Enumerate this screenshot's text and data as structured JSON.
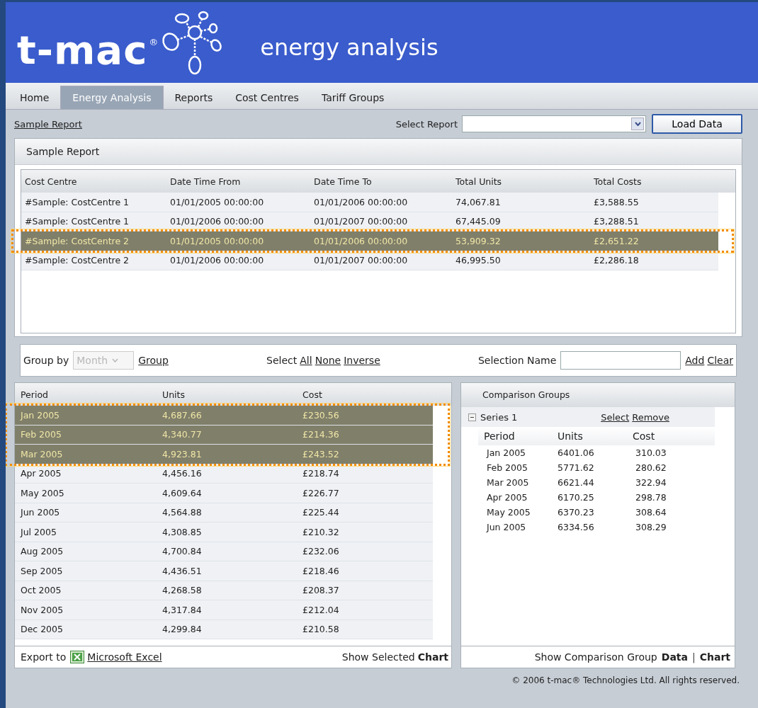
{
  "header": {
    "logo": "t-mac",
    "logo_mark": "®",
    "subtitle": "energy analysis"
  },
  "tabs": [
    {
      "label": "Home",
      "selected": false
    },
    {
      "label": "Energy Analysis",
      "selected": true
    },
    {
      "label": "Reports",
      "selected": false
    },
    {
      "label": "Cost Centres",
      "selected": false
    },
    {
      "label": "Tariff Groups",
      "selected": false
    }
  ],
  "toolbar": {
    "link": "Sample Report",
    "select_label": "Select Report",
    "button": "Load Data"
  },
  "report_panel": {
    "title": "Sample Report",
    "columns": [
      "Cost Centre",
      "Date Time From",
      "Date Time To",
      "Total Units",
      "Total Costs"
    ],
    "rows": [
      {
        "cells": [
          "#Sample: CostCentre 1",
          "01/01/2005 00:00:00",
          "01/01/2006 00:00:00",
          "74,067.81",
          "£3,588.55"
        ],
        "selected": false
      },
      {
        "cells": [
          "#Sample: CostCentre 1",
          "01/01/2006 00:00:00",
          "01/01/2007 00:00:00",
          "67,445.09",
          "£3,288.51"
        ],
        "selected": false
      },
      {
        "cells": [
          "#Sample: CostCentre 2",
          "01/01/2005 00:00:00",
          "01/01/2006 00:00:00",
          "53,909.32",
          "£2,651.22"
        ],
        "selected": true
      },
      {
        "cells": [
          "#Sample: CostCentre 2",
          "01/01/2006 00:00:00",
          "01/01/2007 00:00:00",
          "46,995.50",
          "£2,286.18"
        ],
        "selected": false
      }
    ]
  },
  "group_bar": {
    "group_by_label": "Group by",
    "group_by_value": "Month",
    "group_by_disabled": true,
    "group_link": "Group",
    "select_label": "Select",
    "select_links": [
      "All",
      "None",
      "Inverse"
    ],
    "selection_name_label": "Selection Name",
    "actions": [
      "Add",
      "Clear"
    ]
  },
  "period_table": {
    "columns": [
      "Period",
      "Units",
      "Cost"
    ],
    "rows": [
      {
        "cells": [
          "Jan 2005",
          "4,687.66",
          "£230.56"
        ],
        "selected": true
      },
      {
        "cells": [
          "Feb 2005",
          "4,340.77",
          "£214.36"
        ],
        "selected": true
      },
      {
        "cells": [
          "Mar 2005",
          "4,923.81",
          "£243.52"
        ],
        "selected": true
      },
      {
        "cells": [
          "Apr 2005",
          "4,456.16",
          "£218.74"
        ],
        "selected": false
      },
      {
        "cells": [
          "May 2005",
          "4,609.64",
          "£226.77"
        ],
        "selected": false
      },
      {
        "cells": [
          "Jun 2005",
          "4,564.88",
          "£225.44"
        ],
        "selected": false
      },
      {
        "cells": [
          "Jul 2005",
          "4,308.85",
          "£210.32"
        ],
        "selected": false
      },
      {
        "cells": [
          "Aug 2005",
          "4,700.84",
          "£232.06"
        ],
        "selected": false
      },
      {
        "cells": [
          "Sep 2005",
          "4,436.51",
          "£218.46"
        ],
        "selected": false
      },
      {
        "cells": [
          "Oct 2005",
          "4,268.58",
          "£208.37"
        ],
        "selected": false
      },
      {
        "cells": [
          "Nov 2005",
          "4,317.84",
          "£212.04"
        ],
        "selected": false
      },
      {
        "cells": [
          "Dec 2005",
          "4,299.84",
          "£210.58"
        ],
        "selected": false
      }
    ],
    "export_label": "Export to",
    "export_link": "Microsoft Excel",
    "show_label": "Show Selected",
    "show_link": "Chart"
  },
  "comparison": {
    "title": "Comparison Groups",
    "series": [
      {
        "name": "Series 1",
        "expanded": true,
        "actions": [
          "Select",
          "Remove"
        ],
        "columns": [
          "Period",
          "Units",
          "Cost"
        ],
        "rows": [
          [
            "Jan 2005",
            "6401.06",
            "310.03"
          ],
          [
            "Feb 2005",
            "5771.62",
            "280.62"
          ],
          [
            "Mar 2005",
            "6621.44",
            "322.94"
          ],
          [
            "Apr 2005",
            "6170.25",
            "298.78"
          ],
          [
            "May 2005",
            "6370.23",
            "308.64"
          ],
          [
            "Jun 2005",
            "6334.56",
            "308.29"
          ]
        ]
      }
    ],
    "footer_label": "Show Comparison Group",
    "footer_links": [
      "Data",
      "Chart"
    ],
    "separator": "|"
  },
  "copyright": "© 2006 t-mac® Technologies Ltd. All rights reserved."
}
